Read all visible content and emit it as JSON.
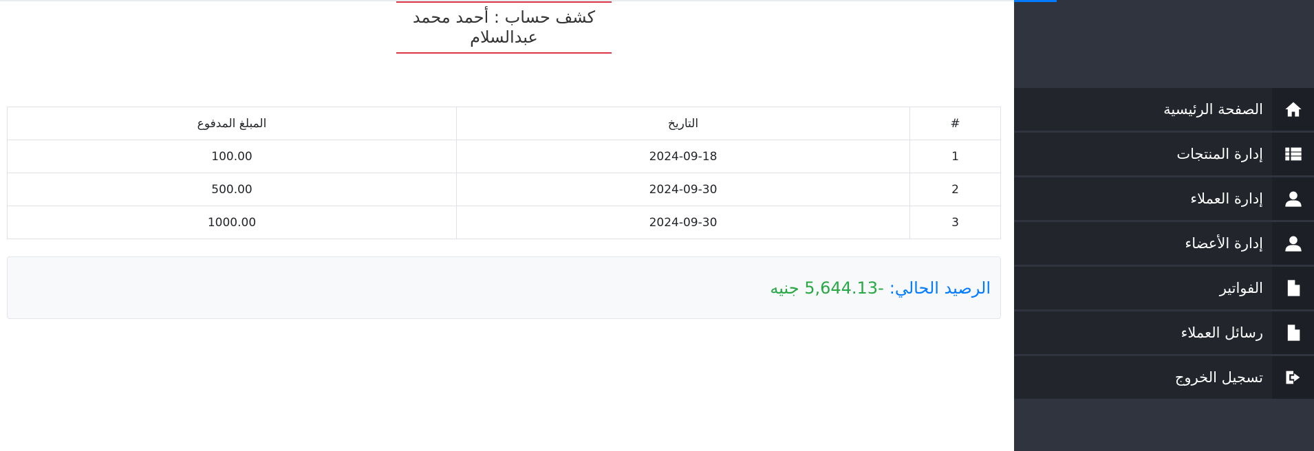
{
  "statement": {
    "title": "كشف حساب : أحمد محمد عبدالسلام"
  },
  "table": {
    "headers": {
      "num": "#",
      "date": "التاريخ",
      "amount": "المبلغ المدفوع"
    },
    "rows": [
      {
        "num": "1",
        "date": "2024-09-18",
        "amount": "100.00"
      },
      {
        "num": "2",
        "date": "2024-09-30",
        "amount": "500.00"
      },
      {
        "num": "3",
        "date": "2024-09-30",
        "amount": "1000.00"
      }
    ]
  },
  "balance": {
    "label": "الرصيد الحالي:",
    "value": "-5,644.13 جنيه"
  },
  "sidebar": {
    "items": [
      {
        "label": "الصفحة الرئيسية",
        "icon": "home-icon"
      },
      {
        "label": "إدارة المنتجات",
        "icon": "list-icon"
      },
      {
        "label": "إدارة العملاء",
        "icon": "user-icon"
      },
      {
        "label": "إدارة الأعضاء",
        "icon": "user-icon"
      },
      {
        "label": "الفواتير",
        "icon": "file-icon"
      },
      {
        "label": "رسائل العملاء",
        "icon": "file-icon"
      },
      {
        "label": "تسجيل الخروج",
        "icon": "logout-icon"
      }
    ]
  },
  "colors": {
    "sidebar_bg": "#30343f",
    "menu_item_bg": "#22252c",
    "accent": "#007bff",
    "title_border": "#dc3545",
    "balance_label": "#007bff",
    "balance_value": "#28a745"
  }
}
